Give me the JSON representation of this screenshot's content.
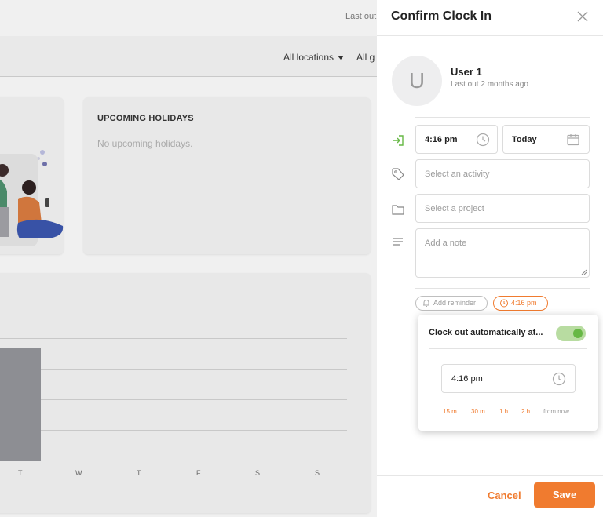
{
  "background": {
    "last_out_partial": "Last out",
    "filters": {
      "locations": "All locations",
      "groups_partial": "All g"
    },
    "holidays_card": {
      "title": "UPCOMING HOLIDAYS",
      "empty_text": "No upcoming holidays."
    },
    "chart_day_labels": [
      "T",
      "W",
      "T",
      "F",
      "S",
      "S"
    ]
  },
  "panel": {
    "title": "Confirm Clock In",
    "close_icon": "close-icon",
    "user": {
      "avatar_letter": "U",
      "name": "User 1",
      "last_out": "Last out 2 months ago"
    },
    "time": {
      "value": "4:16 pm",
      "icon": "clock-icon"
    },
    "date": {
      "value": "Today",
      "icon": "calendar-icon"
    },
    "activity": {
      "placeholder": "Select an activity",
      "icon": "tag-icon"
    },
    "project": {
      "placeholder": "Select a project",
      "icon": "folder-icon"
    },
    "note": {
      "placeholder": "Add a note",
      "icon": "lines-icon"
    },
    "reminder_pill": {
      "label": "Add reminder",
      "icon": "bell-icon"
    },
    "auto_clockout_pill": {
      "label": "4:16 pm",
      "icon": "alarm-icon"
    }
  },
  "popover": {
    "label": "Clock out automatically at...",
    "toggle_on": true,
    "time_value": "4:16 pm",
    "quick_options": [
      "15 m",
      "30 m",
      "1 h",
      "2 h"
    ],
    "from_now": "from now"
  },
  "footer": {
    "cancel": "Cancel",
    "save": "Save"
  },
  "colors": {
    "accent": "#f07b2f",
    "toggle_on": "#67b845",
    "clock_in_green": "#67b845"
  }
}
